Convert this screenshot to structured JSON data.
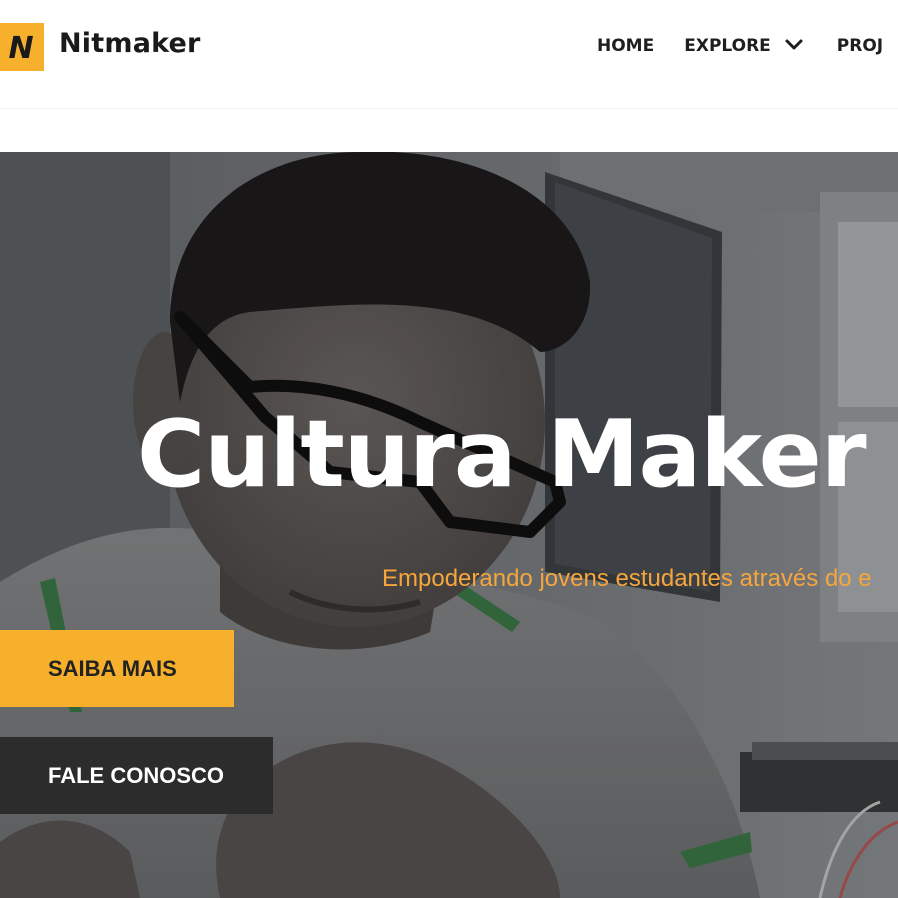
{
  "header": {
    "brand": "Nitmaker",
    "logo_letter": "N",
    "nav": {
      "home": "HOME",
      "explore": "EXPLORE",
      "projects": "PROJ"
    }
  },
  "hero": {
    "title": "Cultura Maker",
    "subtitle": "Empoderando jovens estudantes através do e",
    "buttons": {
      "primary": "SAIBA MAIS",
      "secondary": "FALE CONOSCO"
    }
  },
  "colors": {
    "accent": "#f7b02b",
    "subtitle": "#f7a63b",
    "dark_button": "#2c2c2c",
    "text_dark": "#1f1f1f"
  },
  "icons": {
    "logo": "nitmaker-logo-icon",
    "explore_dropdown": "chevron-down-icon"
  }
}
